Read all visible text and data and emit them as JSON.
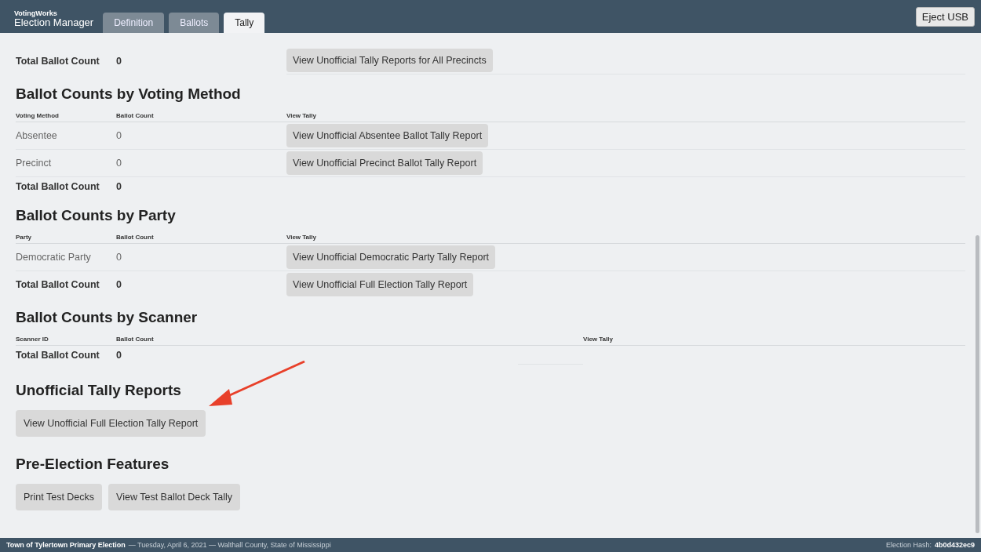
{
  "header": {
    "brand_small": "VotingWorks",
    "brand": "Election Manager",
    "tabs": [
      {
        "label": "Definition",
        "selected": false
      },
      {
        "label": "Ballots",
        "selected": false
      },
      {
        "label": "Tally",
        "selected": true
      }
    ],
    "eject": "Eject USB"
  },
  "top_row": {
    "label": "Total Ballot Count",
    "count": "0",
    "button": "View Unofficial Tally Reports for All Precincts"
  },
  "sections": [
    {
      "kind": "table",
      "title": "Ballot Counts by Voting Method",
      "columns": [
        "Voting Method",
        "Ballot Count",
        "View Tally"
      ],
      "rows": [
        {
          "kind": "row",
          "label": "Absentee",
          "count": "0",
          "button": "View Unofficial Absentee Ballot Tally Report"
        },
        {
          "kind": "row",
          "label": "Precinct",
          "count": "0",
          "button": "View Unofficial Precinct Ballot Tally Report"
        },
        {
          "kind": "total",
          "label": "Total Ballot Count",
          "count": "0"
        }
      ]
    },
    {
      "kind": "table",
      "title": "Ballot Counts by Party",
      "columns": [
        "Party",
        "Ballot Count",
        "View Tally"
      ],
      "rows": [
        {
          "kind": "row",
          "label": "Democratic Party",
          "count": "0",
          "button": "View Unofficial Democratic Party Tally Report"
        },
        {
          "kind": "total",
          "label": "Total Ballot Count",
          "count": "0",
          "button": "View Unofficial Full Election Tally Report"
        }
      ]
    },
    {
      "kind": "scanner_table",
      "title": "Ballot Counts by Scanner",
      "columns": [
        "Scanner ID",
        "Ballot Count",
        "View Tally"
      ],
      "rows": [
        {
          "kind": "total",
          "label": "Total Ballot Count",
          "count": "0"
        }
      ]
    },
    {
      "kind": "buttons",
      "title": "Unofficial Tally Reports",
      "buttons": [
        "View Unofficial Full Election Tally Report"
      ]
    },
    {
      "kind": "buttons",
      "title": "Pre-Election Features",
      "buttons": [
        "Print Test Decks",
        "View Test Ballot Deck Tally"
      ]
    }
  ],
  "annotation": {
    "kind": "arrow"
  },
  "footer": {
    "election": "Town of Tylertown Primary Election",
    "details": "— Tuesday, April 6, 2021 — Walthall County, State of Mississippi",
    "hash_label": "Election Hash:",
    "hash": "4b0d432ec9"
  }
}
